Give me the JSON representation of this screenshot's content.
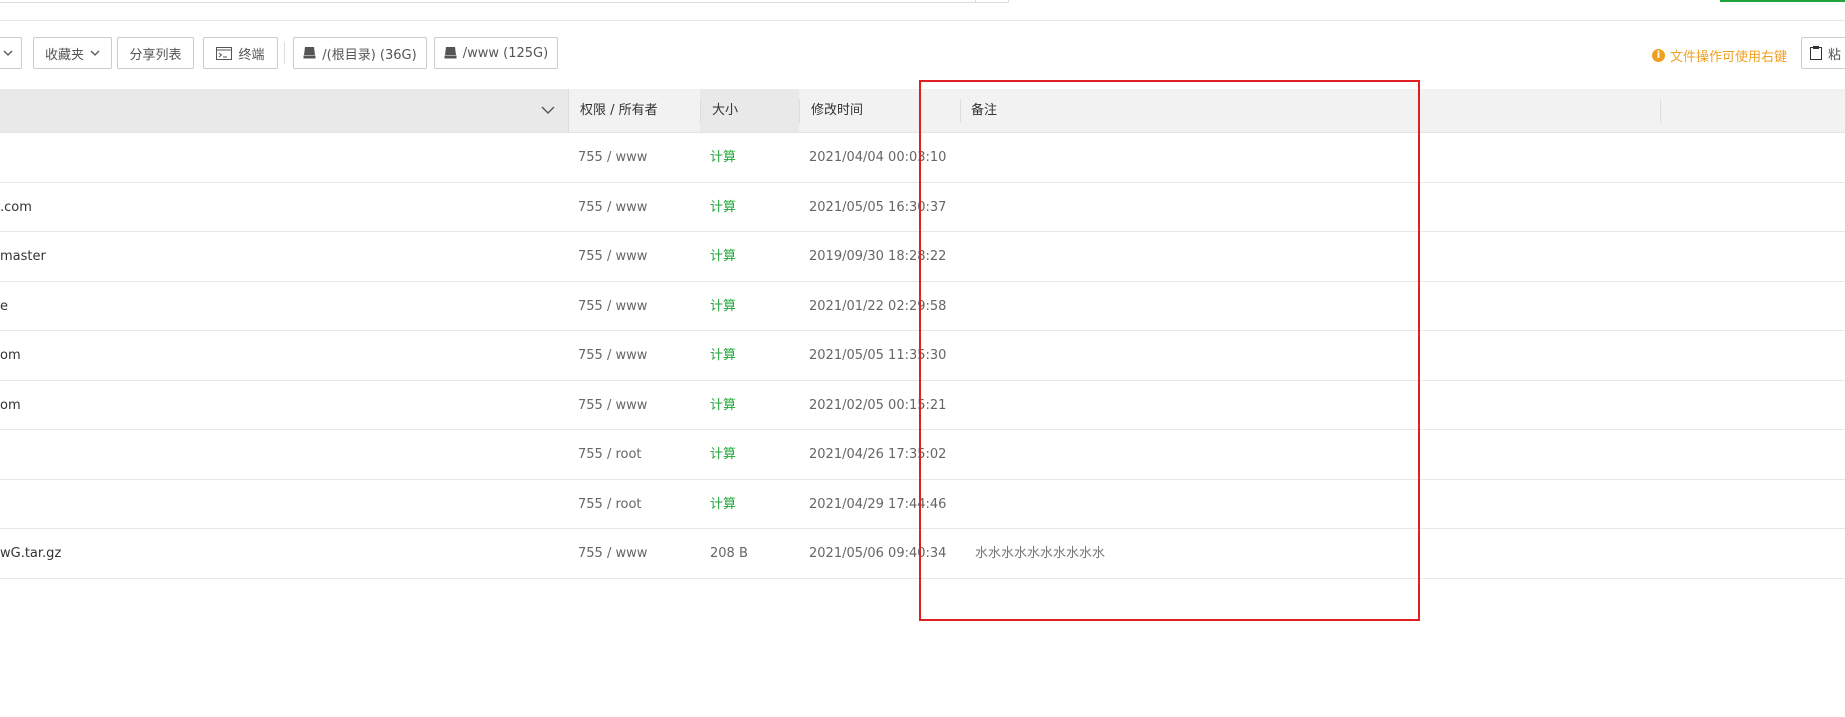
{
  "toolbar": {
    "dropdown_left_label": "",
    "favorites_label": "收藏夹",
    "share_list_label": "分享列表",
    "terminal_label": "终端",
    "disk_root_label": "/(根目录) (36G)",
    "disk_www_label": "/www (125G)",
    "tip_text": "文件操作可使用右键",
    "paste_label": "粘"
  },
  "table": {
    "headers": {
      "permission": "权限 / 所有者",
      "size": "大小",
      "modified": "修改时间",
      "note": "备注"
    },
    "rows": [
      {
        "name": "",
        "permission": "755 / www",
        "size": "计算",
        "modified": "2021/04/04 00:03:10",
        "note": ""
      },
      {
        "name": ".com",
        "permission": "755 / www",
        "size": "计算",
        "modified": "2021/05/05 16:30:37",
        "note": ""
      },
      {
        "name": "master",
        "permission": "755 / www",
        "size": "计算",
        "modified": "2019/09/30 18:28:22",
        "note": ""
      },
      {
        "name": "e",
        "permission": "755 / www",
        "size": "计算",
        "modified": "2021/01/22 02:29:58",
        "note": ""
      },
      {
        "name": "om",
        "permission": "755 / www",
        "size": "计算",
        "modified": "2021/05/05 11:35:30",
        "note": ""
      },
      {
        "name": "om",
        "permission": "755 / www",
        "size": "计算",
        "modified": "2021/02/05 00:15:21",
        "note": ""
      },
      {
        "name": "",
        "permission": "755 / root",
        "size": "计算",
        "modified": "2021/04/26 17:35:02",
        "note": ""
      },
      {
        "name": "",
        "permission": "755 / root",
        "size": "计算",
        "modified": "2021/04/29 17:44:46",
        "note": ""
      },
      {
        "name": "wG.tar.gz",
        "permission": "755 / www",
        "size": "208 B",
        "modified": "2021/05/06 09:40:34",
        "note": "水水水水水水水水水水"
      }
    ]
  },
  "colors": {
    "accent_green": "#20a53a",
    "tip_orange": "#f0a020",
    "highlight_red": "#e02020"
  }
}
